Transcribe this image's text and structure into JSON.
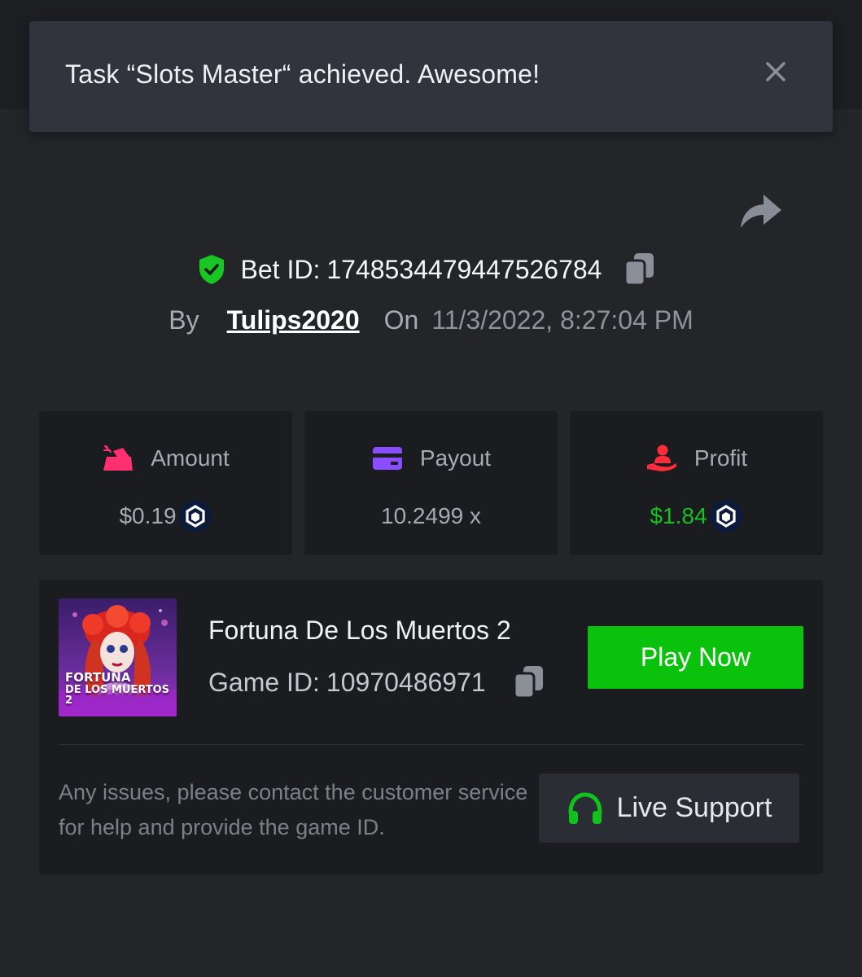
{
  "toast": {
    "message": "Task “Slots Master“ achieved. Awesome!",
    "close_icon": "close-icon"
  },
  "bet": {
    "id_label": "Bet ID:",
    "id_value": "1748534479447526784",
    "by_label": "By",
    "username": "Tulips2020",
    "on_label": "On",
    "date": "11/3/2022, 8:27:04 PM"
  },
  "stats": {
    "amount": {
      "label": "Amount",
      "value": "$0.19",
      "icon": "gem-cart-icon",
      "color": "#ff2f72"
    },
    "payout": {
      "label": "Payout",
      "value": "10.2499 x",
      "icon": "card-icon",
      "color": "#8a4dff"
    },
    "profit": {
      "label": "Profit",
      "value": "$1.84",
      "icon": "hand-user-icon",
      "color": "#ff2c3c",
      "value_color": "#16c21e"
    }
  },
  "game": {
    "title": "Fortuna De Los Muertos 2",
    "id_label": "Game ID:",
    "id_value": "10970486971",
    "thumb_line1": "FORTUNA",
    "thumb_line2": "DE LOS MUERTOS 2",
    "play_label": "Play Now"
  },
  "support": {
    "help_text": "Any issues, please contact the customer service for help and provide the game ID.",
    "button_label": "Live Support"
  },
  "colors": {
    "background": "#232529",
    "card": "#1a1c20",
    "accent_green": "#0ac10c",
    "toast": "#31343d"
  }
}
